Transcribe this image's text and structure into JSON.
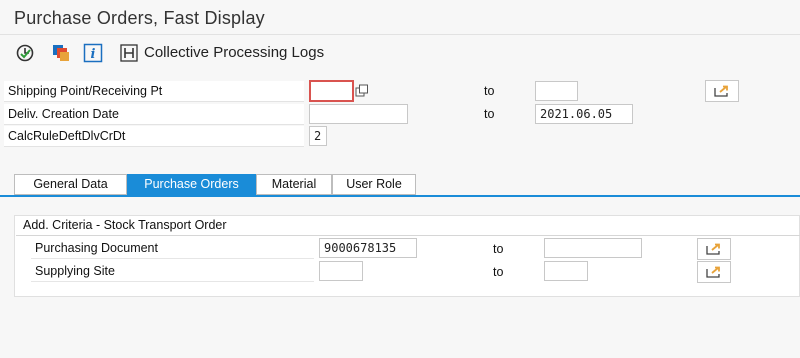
{
  "window": {
    "title": "Purchase Orders, Fast Display"
  },
  "toolbar": {
    "execute_icon": "execute-clock-icon",
    "variant_icon": "variant-layers-icon",
    "info_icon": "info-icon",
    "logs_label": "Collective Processing Logs"
  },
  "selection": {
    "to_label": "to",
    "rows": [
      {
        "label": "Shipping Point/Receiving Pt",
        "from": "",
        "to": ""
      },
      {
        "label": "Deliv. Creation Date",
        "from": "",
        "to": "2021.06.05"
      },
      {
        "label": "CalcRuleDeftDlvCrDt",
        "value": "2"
      }
    ]
  },
  "tabs": [
    {
      "label": "General Data",
      "active": false
    },
    {
      "label": "Purchase Orders",
      "active": true
    },
    {
      "label": "Material",
      "active": false
    },
    {
      "label": "User Role",
      "active": false
    }
  ],
  "panel": {
    "title": "Add. Criteria - Stock Transport Order",
    "to_label": "to",
    "rows": [
      {
        "label": "Purchasing Document",
        "from": "9000678135",
        "to": ""
      },
      {
        "label": "Supplying Site",
        "from": "",
        "to": ""
      }
    ]
  },
  "colors": {
    "accent": "#1a8cd8",
    "focus": "#d9534f",
    "icon_orange": "#e8a33a"
  }
}
